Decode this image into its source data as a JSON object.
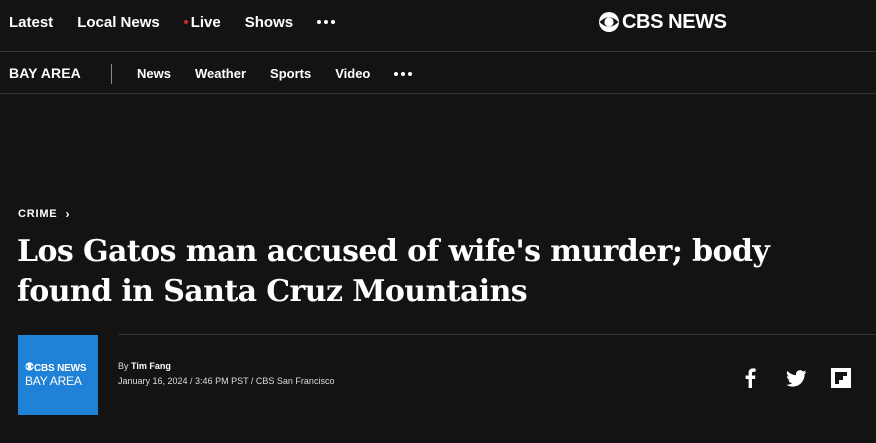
{
  "top_nav": {
    "items": [
      "Latest",
      "Local News",
      "Live",
      "Shows"
    ],
    "more_icon": "ellipsis-icon"
  },
  "brand": {
    "logo_icon": "cbs-eye-icon",
    "logo_text": "CBS NEWS"
  },
  "section_nav": {
    "region": "BAY AREA",
    "items": [
      "News",
      "Weather",
      "Sports",
      "Video"
    ],
    "more_icon": "ellipsis-icon"
  },
  "article": {
    "category": "CRIME",
    "headline": "Los Gatos man accused of wife's murder; body found in Santa Cruz Mountains",
    "byline_prefix": "By",
    "author": "Tim Fang",
    "dateline": "January 16, 2024 / 3:46 PM PST / CBS San Francisco",
    "source_logo_line1": "CBS NEWS",
    "source_logo_line2": "BAY AREA"
  },
  "share": {
    "icons": [
      "facebook-icon",
      "twitter-icon",
      "flipboard-icon"
    ]
  },
  "colors": {
    "background": "#131313",
    "live_dot": "#d02a2a",
    "source_logo_bg": "#1f82d6",
    "text": "#ffffff"
  }
}
